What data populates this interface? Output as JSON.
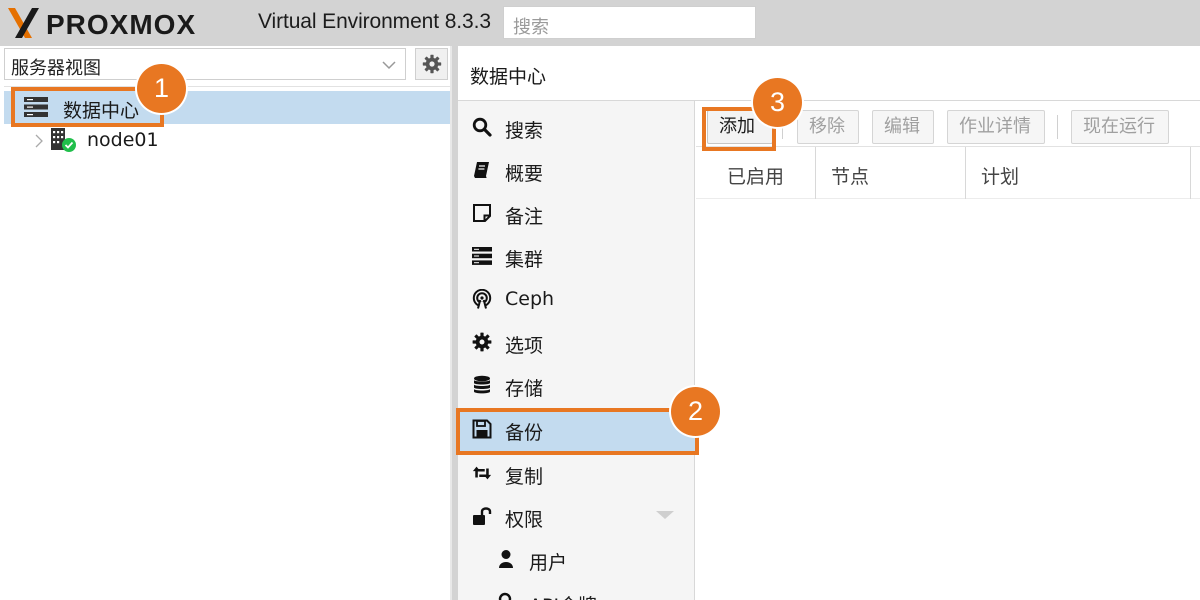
{
  "header": {
    "logo_text": "PROXMOX",
    "product_version": "Virtual Environment 8.3.3",
    "search_placeholder": "搜索"
  },
  "left_panel": {
    "view_selector": {
      "value": "服务器视图"
    },
    "tree": [
      {
        "label": "数据中心",
        "icon": "datacenter-icon",
        "selected": true
      },
      {
        "label": "node01",
        "icon": "node-online-icon",
        "selected": false
      }
    ]
  },
  "right_panel": {
    "title": "数据中心",
    "nav": {
      "items": [
        {
          "label": "搜索",
          "icon": "search-icon"
        },
        {
          "label": "概要",
          "icon": "summary-book-icon"
        },
        {
          "label": "备注",
          "icon": "notes-icon"
        },
        {
          "label": "集群",
          "icon": "cluster-icon"
        },
        {
          "label": "Ceph",
          "icon": "ceph-icon"
        },
        {
          "label": "选项",
          "icon": "gear-icon"
        },
        {
          "label": "存储",
          "icon": "database-icon"
        },
        {
          "label": "备份",
          "icon": "floppy-save-icon",
          "selected": true
        },
        {
          "label": "复制",
          "icon": "retweet-icon"
        },
        {
          "label": "权限",
          "icon": "unlock-icon",
          "expandable": true
        },
        {
          "label": "用户",
          "icon": "user-icon",
          "sub": true
        },
        {
          "label": "API令牌",
          "icon": "key-icon",
          "sub": true
        }
      ]
    },
    "toolbar": {
      "add_label": "添加",
      "remove_label": "移除",
      "edit_label": "编辑",
      "job_detail_label": "作业详情",
      "run_now_label": "现在运行"
    },
    "grid": {
      "columns": [
        "已启用",
        "节点",
        "计划"
      ]
    }
  },
  "annotations": {
    "step1": "1",
    "step2": "2",
    "step3": "3",
    "color": "#e87722"
  }
}
